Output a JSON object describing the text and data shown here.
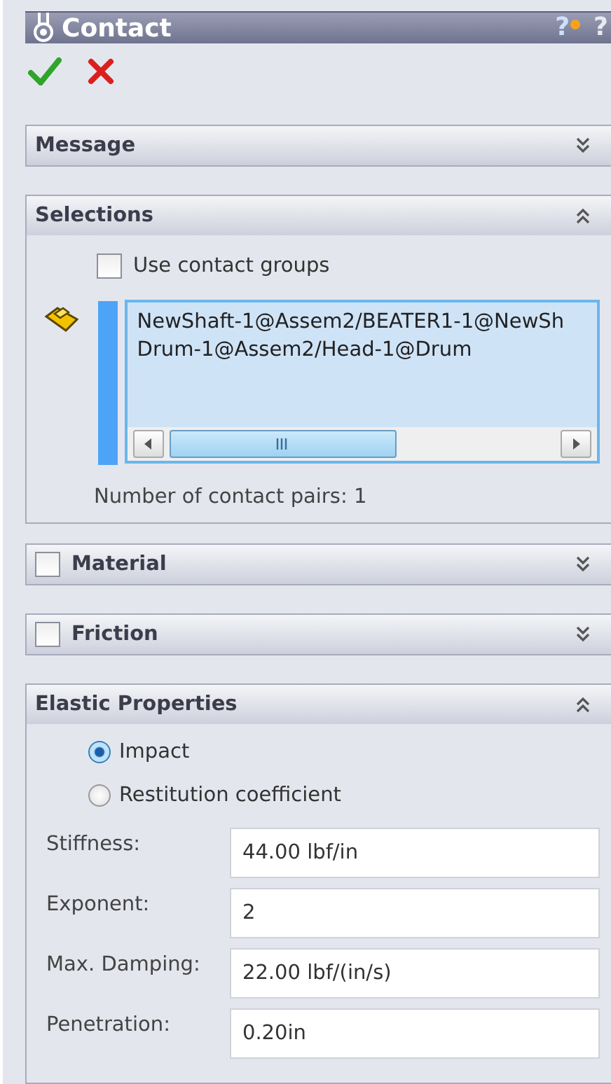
{
  "title": "Contact",
  "help_marks": [
    "?",
    "?"
  ],
  "sections": [
    {
      "kind": "plain",
      "title": "Message",
      "expanded": false
    },
    {
      "kind": "selections",
      "title": "Selections",
      "expanded": true,
      "use_groups": {
        "label": "Use contact groups",
        "checked": false
      },
      "selection_lines": [
        "NewShaft-1@Assem2/BEATER1-1@NewSh",
        "Drum-1@Assem2/Head-1@Drum"
      ],
      "pairs_text": "Number of contact pairs: 1"
    },
    {
      "kind": "optional",
      "title": "Material",
      "checked": false,
      "expanded": false
    },
    {
      "kind": "optional",
      "title": "Friction",
      "checked": false,
      "expanded": false
    },
    {
      "kind": "elastic",
      "title": "Elastic Properties",
      "expanded": true,
      "options": [
        {
          "label": "Impact",
          "selected": true
        },
        {
          "label": "Restitution coefficient",
          "selected": false
        }
      ],
      "fields": [
        {
          "label": "Stiffness:",
          "value": "44.00 lbf/in"
        },
        {
          "label": "Exponent:",
          "value": "2"
        },
        {
          "label": "Max. Damping:",
          "value": "22.00 lbf/(in/s)"
        },
        {
          "label": "Penetration:",
          "value": "0.20in"
        }
      ]
    }
  ]
}
